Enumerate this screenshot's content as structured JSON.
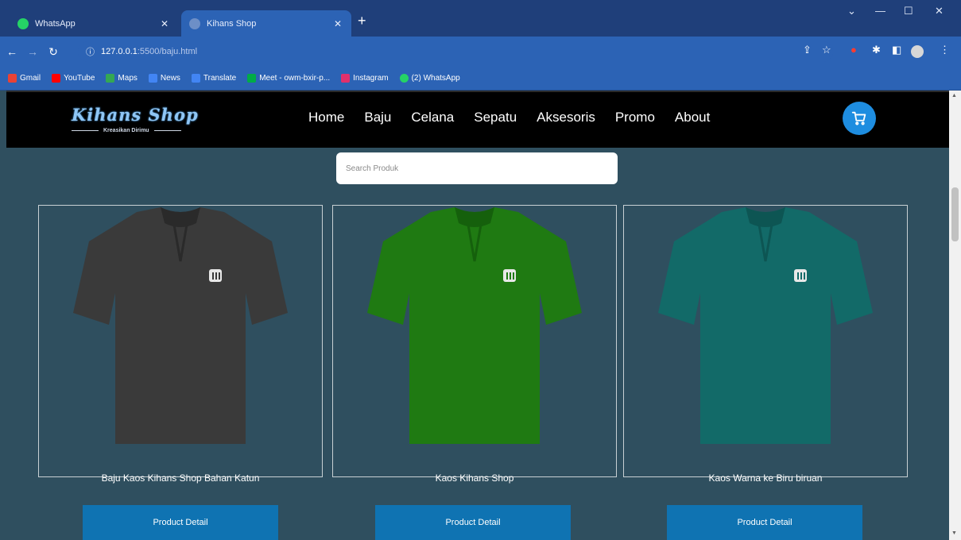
{
  "browser": {
    "tabs": [
      {
        "label": "WhatsApp",
        "active": false,
        "icon": "whatsapp-icon",
        "color": "#25d366"
      },
      {
        "label": "Kihans Shop",
        "active": true,
        "icon": "globe-icon",
        "color": "#6d8fc7"
      }
    ],
    "address": {
      "host": "127.0.0.1",
      "path": ":5500/baju.html"
    },
    "bookmarks": [
      {
        "label": "Gmail",
        "color": "#e94235"
      },
      {
        "label": "YouTube",
        "color": "#ff0000"
      },
      {
        "label": "Maps",
        "color": "#34a853"
      },
      {
        "label": "News",
        "color": "#4285f4"
      },
      {
        "label": "Translate",
        "color": "#4285f4"
      },
      {
        "label": "Meet - owm-bxir-p...",
        "color": "#00ac47"
      },
      {
        "label": "Instagram",
        "color": "#e1306c"
      },
      {
        "label": "(2) WhatsApp",
        "color": "#25d366"
      }
    ]
  },
  "site": {
    "logo_name": "Kihans Shop",
    "logo_tagline": "Kreasikan Dirimu",
    "menu": [
      "Home",
      "Baju",
      "Celana",
      "Sepatu",
      "Aksesoris",
      "Promo",
      "About"
    ],
    "search_placeholder": "Search Produk",
    "accent": "#1e8de0",
    "button_color": "#0f73b2"
  },
  "products": [
    {
      "title": "Baju Kaos Kihans Shop Bahan Katun",
      "shirt_color": "#3a3a3a",
      "shade": "#2a2a2a",
      "button": "Product Detail"
    },
    {
      "title": "Kaos Kihans Shop",
      "shirt_color": "#1f7a12",
      "shade": "#15600c",
      "button": "Product Detail"
    },
    {
      "title": "Kaos Warna ke Biru biruan",
      "shirt_color": "#126a68",
      "shade": "#0d5553",
      "button": "Product Detail"
    }
  ]
}
